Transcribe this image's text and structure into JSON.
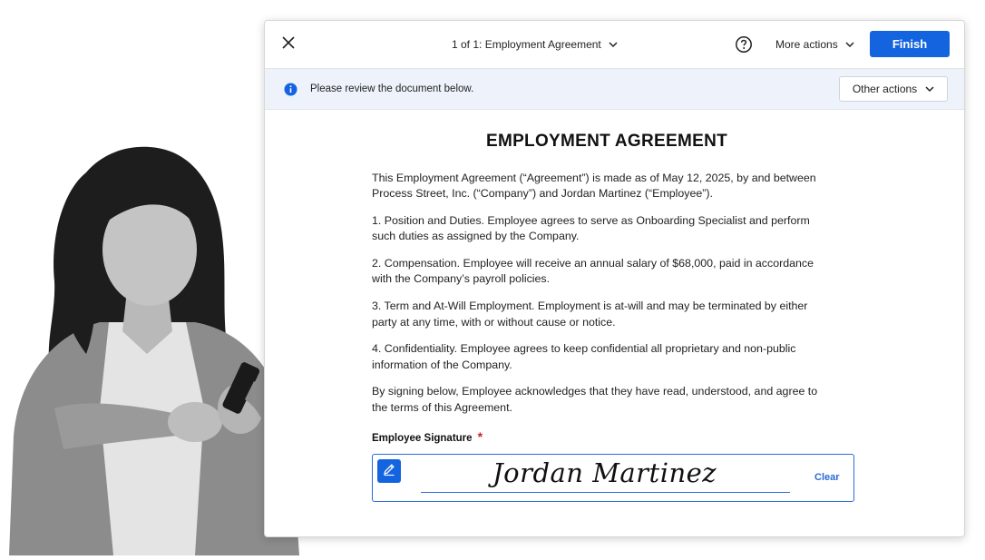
{
  "toolbar": {
    "doc_selector": "1 of 1: Employment Agreement",
    "more_actions": "More actions",
    "finish": "Finish"
  },
  "infobar": {
    "message": "Please review the document below.",
    "other_actions": "Other actions"
  },
  "document": {
    "title": "EMPLOYMENT AGREEMENT",
    "paragraphs": [
      "This Employment Agreement (“Agreement”) is made as of May 12, 2025, by and between Process Street, Inc. (“Company”) and Jordan Martinez (“Employee”).",
      "1. Position and Duties. Employee agrees to serve as Onboarding Specialist and perform such duties as assigned by the Company.",
      "2. Compensation. Employee will receive an annual salary of $68,000, paid in accordance with the Company’s payroll policies.",
      "3. Term and At-Will Employment. Employment is at-will and may be terminated by either party at any time, with or without cause or notice.",
      "4. Confidentiality. Employee agrees to keep confidential all proprietary and non-public information of the Company.",
      "By signing below, Employee acknowledges that they have read, understood, and agree to the terms of this Agreement."
    ],
    "signature_label": "Employee Signature",
    "required_marker": "*",
    "signature_value": "Jordan Martinez",
    "clear": "Clear"
  },
  "colors": {
    "accent": "#1464e0",
    "info_bg": "#eef3fb",
    "required": "#d21e2a"
  },
  "icons": [
    "close-icon",
    "chevron-down-icon",
    "help-icon",
    "info-icon",
    "pen-icon"
  ]
}
